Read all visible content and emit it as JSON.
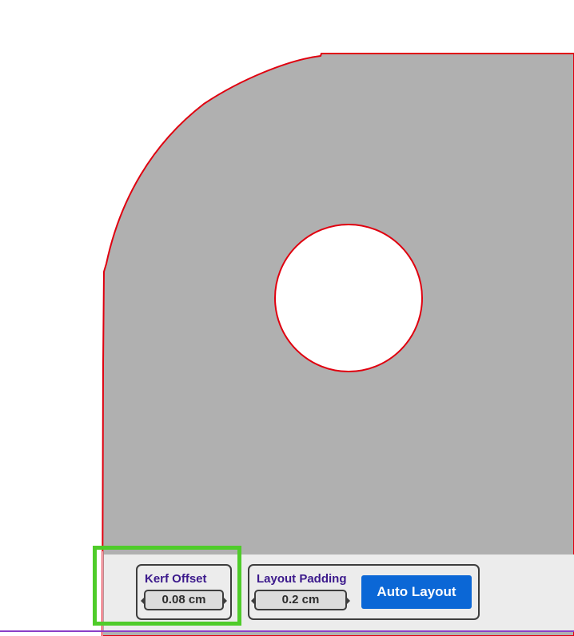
{
  "canvas": {
    "part_fill": "#b0b0b0",
    "outline_color": "#e0000f",
    "hole_fill": "#ffffff"
  },
  "toolbar": {
    "kerf_offset": {
      "label": "Kerf Offset",
      "value": "0.08 cm"
    },
    "layout_padding": {
      "label": "Layout Padding",
      "value": "0.2 cm"
    },
    "auto_layout_label": "Auto Layout"
  },
  "colors": {
    "label_text": "#3c1a8c",
    "button_blue": "#0b67d6",
    "highlight_green": "#4fcc2a",
    "bottom_line": "#8a3fc7"
  }
}
